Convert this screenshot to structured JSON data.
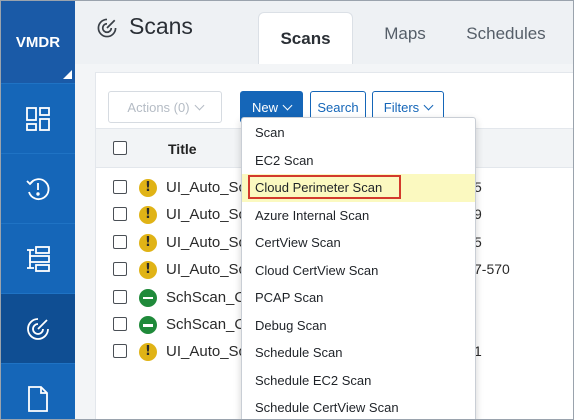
{
  "brand": {
    "name": "VMDR"
  },
  "rail": {
    "items": [
      {
        "name": "dashboard-icon"
      },
      {
        "name": "alert-clock-icon"
      },
      {
        "name": "list-stack-icon"
      },
      {
        "name": "scan-radar-icon",
        "active": true
      },
      {
        "name": "document-icon"
      }
    ]
  },
  "header": {
    "title": "Scans",
    "tabs": [
      {
        "label": "Scans",
        "active": true
      },
      {
        "label": "Maps"
      },
      {
        "label": "Schedules"
      }
    ]
  },
  "toolbar": {
    "actions_label": "Actions (0)",
    "new_label": "New",
    "search_label": "Search",
    "filters_label": "Filters"
  },
  "table": {
    "title_header": "Title",
    "rows": [
      {
        "name": "UI_Auto_Sc",
        "status": "warn",
        "extra": "5"
      },
      {
        "name": "UI_Auto_Sc",
        "status": "warn",
        "extra": "9"
      },
      {
        "name": "UI_Auto_Sc",
        "status": "warn",
        "extra": "5"
      },
      {
        "name": "UI_Auto_Sc",
        "status": "warn",
        "extra": "7-570"
      },
      {
        "name": "SchScan_C",
        "status": "ok",
        "extra": ""
      },
      {
        "name": "SchScan_C",
        "status": "ok",
        "extra": ""
      },
      {
        "name": "UI_Auto_Sc",
        "status": "warn",
        "extra": "1"
      }
    ]
  },
  "new_menu": {
    "items": [
      {
        "label": "Scan"
      },
      {
        "label": "EC2 Scan"
      },
      {
        "label": "Cloud Perimeter Scan",
        "highlighted": true
      },
      {
        "label": "Azure Internal Scan"
      },
      {
        "label": "CertView Scan"
      },
      {
        "label": "Cloud CertView Scan"
      },
      {
        "label": "PCAP Scan"
      },
      {
        "label": "Debug Scan"
      },
      {
        "label": "Schedule Scan"
      },
      {
        "label": "Schedule EC2 Scan"
      },
      {
        "label": "Schedule CertView Scan"
      }
    ]
  },
  "colors": {
    "primary": "#1566b8",
    "rail_active": "#0f4e93",
    "warning": "#e0b316",
    "ok": "#1f8a3a",
    "highlight_bg": "#fbf9c0",
    "highlight_border": "#d33a2c"
  }
}
